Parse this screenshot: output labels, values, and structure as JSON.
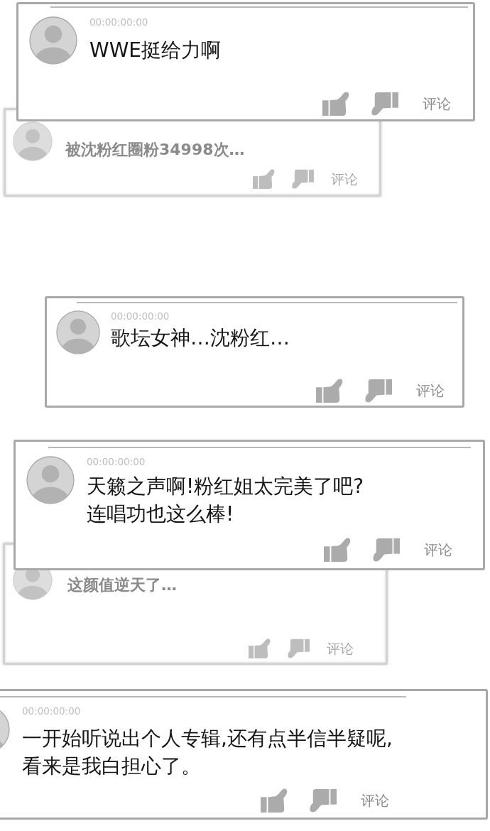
{
  "comments": [
    {
      "blurred": false,
      "timestamp": "00:00:00:00",
      "text": "WWE挺给力啊",
      "comment_label": "评论"
    },
    {
      "blurred": true,
      "text": "被沈粉红圈粉34998次…",
      "comment_label": "评论"
    },
    {
      "blurred": false,
      "timestamp": "00:00:00:00",
      "text": "歌坛女神…沈粉红…",
      "comment_label": "评论"
    },
    {
      "blurred": false,
      "timestamp": "00:00:00:00",
      "text": "天籁之声啊!粉红姐太完美了吧?\n连唱功也这么棒!",
      "comment_label": "评论"
    },
    {
      "blurred": true,
      "text": "这颜值逆天了…",
      "comment_label": "评论"
    },
    {
      "blurred": false,
      "timestamp": "00:00:00:00",
      "text": "一开始听说出个人专辑,还有点半信半疑呢,\n看来是我白担心了。",
      "comment_label": "评论"
    }
  ]
}
